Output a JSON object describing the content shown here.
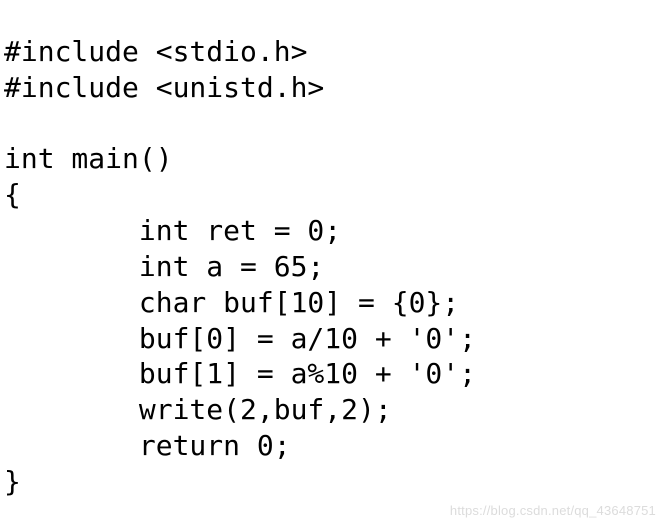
{
  "code": {
    "lines": [
      "#include <stdio.h>",
      "#include <unistd.h>",
      "",
      "int main()",
      "{",
      "        int ret = 0;",
      "        int a = 65;",
      "        char buf[10] = {0};",
      "        buf[0] = a/10 + '0';",
      "        buf[1] = a%10 + '0';",
      "        write(2,buf,2);",
      "        return 0;",
      "}"
    ]
  },
  "watermark": {
    "text": "https://blog.csdn.net/qq_43648751"
  }
}
